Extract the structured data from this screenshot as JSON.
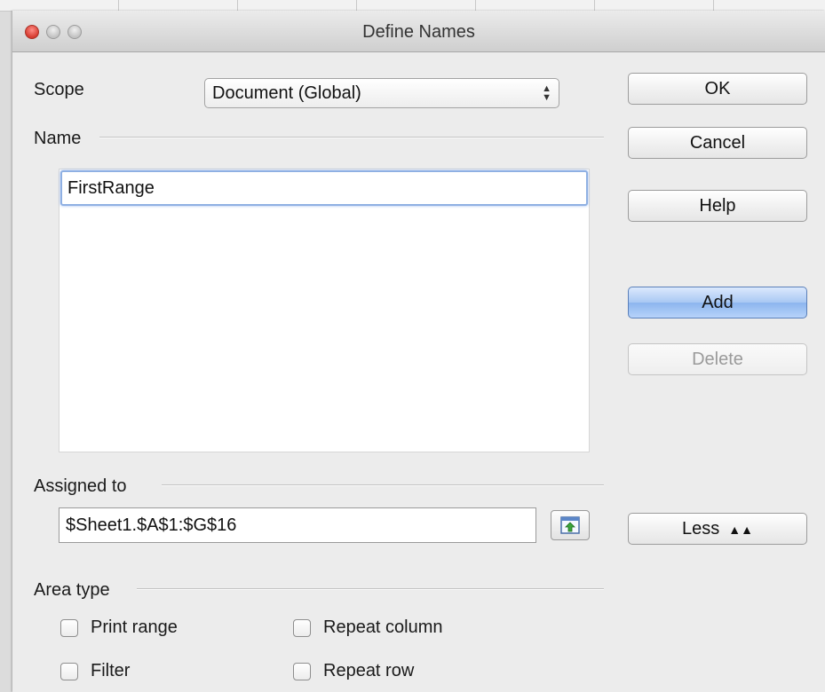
{
  "window": {
    "title": "Define Names"
  },
  "scope": {
    "label": "Scope",
    "value": "Document (Global)"
  },
  "name": {
    "label": "Name",
    "value": "FirstRange"
  },
  "assigned": {
    "label": "Assigned to",
    "value": "$Sheet1.$A$1:$G$16"
  },
  "area_type": {
    "label": "Area type",
    "print_range": "Print range",
    "repeat_column": "Repeat column",
    "filter": "Filter",
    "repeat_row": "Repeat row"
  },
  "buttons": {
    "ok": "OK",
    "cancel": "Cancel",
    "help": "Help",
    "add": "Add",
    "delete": "Delete",
    "less": "Less"
  },
  "icons": {
    "close": "close-window-icon",
    "minimize": "minimize-window-icon",
    "maximize": "zoom-window-icon",
    "select_arrows": "updown-arrows-icon",
    "shrink": "shrink-dialog-icon",
    "less": "double-chevron-up-icon"
  },
  "colors": {
    "accent": "#8cb5ee",
    "focus": "#8fb0e3",
    "close": "#d63b30"
  }
}
